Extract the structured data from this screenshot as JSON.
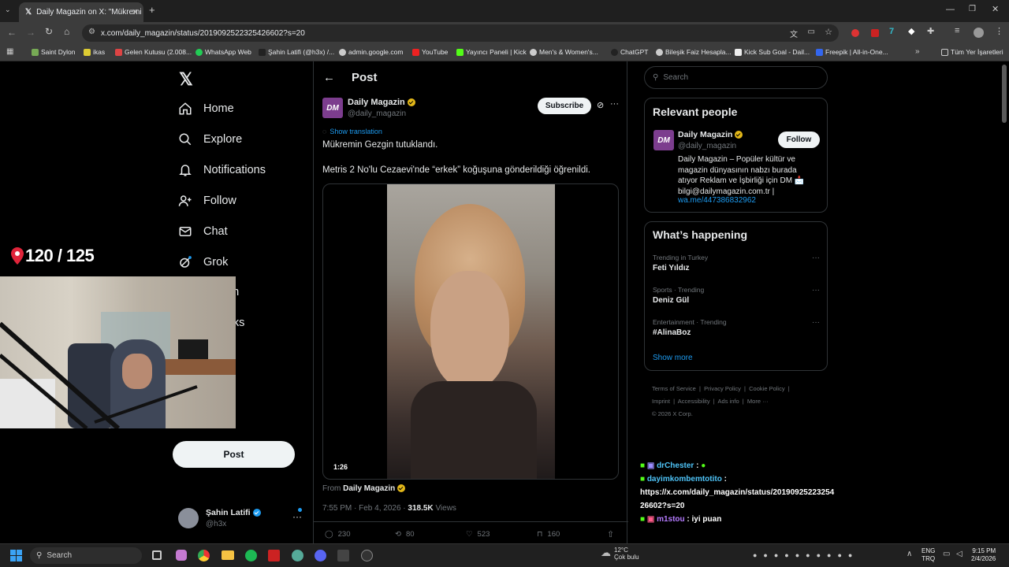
{
  "browser": {
    "tab_title": "Daily Magazin on X: \"Mükremi",
    "url": "x.com/daily_magazin/status/2019092522325426602?s=20",
    "bookmarks": [
      "Saint Dylon",
      "ikas",
      "Gelen Kutusu (2.008...",
      "WhatsApp Web",
      "Şahin Latifi (@h3x) /...",
      "admin.google.com",
      "YouTube",
      "Yayıncı Paneli | Kick",
      "Men's & Women's...",
      "ChatGPT",
      "Bileşik Faiz Hesapla...",
      "Kick Sub Goal - Dail...",
      "Freepik | All-in-One..."
    ],
    "all_bookmarks": "Tüm Yer İşaretleri"
  },
  "nav": {
    "items": [
      "Home",
      "Explore",
      "Notifications",
      "Follow",
      "Chat",
      "Grok",
      "um",
      "arks",
      "s"
    ],
    "post_label": "Post",
    "user_name": "Şahin Latifi",
    "user_handle": "@h3x"
  },
  "overlay": {
    "counter": "120 / 125"
  },
  "post": {
    "header": "Post",
    "author_name": "Daily Magazin",
    "author_handle": "@daily_magazin",
    "avatar_text": "DM",
    "subscribe_label": "Subscribe",
    "show_translation": "Show translation",
    "text_line1": "Mükremin Gezgin tutuklandı.",
    "text_line2": "Metris 2 No'lu Cezaevi'nde “erkek” koğuşuna gönderildiği öğrenildi.",
    "video_duration": "1:26",
    "from_label": "From",
    "from_name": "Daily Magazin",
    "timestamp": "7:55 PM · Feb 4, 2026 ·",
    "views_count": "318.5K",
    "views_label": "Views",
    "replies": "230",
    "reposts": "80",
    "likes": "523",
    "bookmarks": "160"
  },
  "sidebar": {
    "search_placeholder": "Search",
    "relevant_title": "Relevant people",
    "person_name": "Daily Magazin",
    "person_handle": "@daily_magazin",
    "follow_label": "Follow",
    "bio": "Daily Magazin – Popüler kültür ve magazin dünyasının nabzı burada atıyor Reklam ve İşbirliği için DM 📩 bilgi@dailymagazin.com.tr |",
    "bio_link": "wa.me/447386832962",
    "happening_title": "What’s happening",
    "trends": [
      {
        "context": "Trending in Turkey",
        "topic": "Feti Yıldız"
      },
      {
        "context": "Sports · Trending",
        "topic": "Deniz Gül"
      },
      {
        "context": "Entertainment · Trending",
        "topic": "#AlinaBoz"
      }
    ],
    "show_more": "Show more",
    "footer": [
      "Terms of Service",
      "Privacy Policy",
      "Cookie Policy",
      "Imprint",
      "Accessibility",
      "Ads info",
      "More ···"
    ],
    "copyright": "© 2026 X Corp."
  },
  "chat": {
    "lines": [
      {
        "user": "drChester",
        "text": ":"
      },
      {
        "user": "dayimkombemtotito",
        "text": ":"
      },
      {
        "user": "",
        "text": "https://x.com/daily_magazin/status/20190925223254"
      },
      {
        "user": "",
        "text": "26602?s=20"
      },
      {
        "user": "m1stou",
        "text": ": iyi puan"
      }
    ]
  },
  "taskbar": {
    "search": "Search",
    "weather_temp": "12°C",
    "weather_text": "Çok bulu",
    "lang1": "ENG",
    "lang2": "TRQ",
    "time": "9:15 PM",
    "date": "2/4/2026"
  },
  "colors": {
    "accent": "#1d9bf0",
    "verified_gold": "#e2b719",
    "dm_purple": "#7c3d8e"
  }
}
